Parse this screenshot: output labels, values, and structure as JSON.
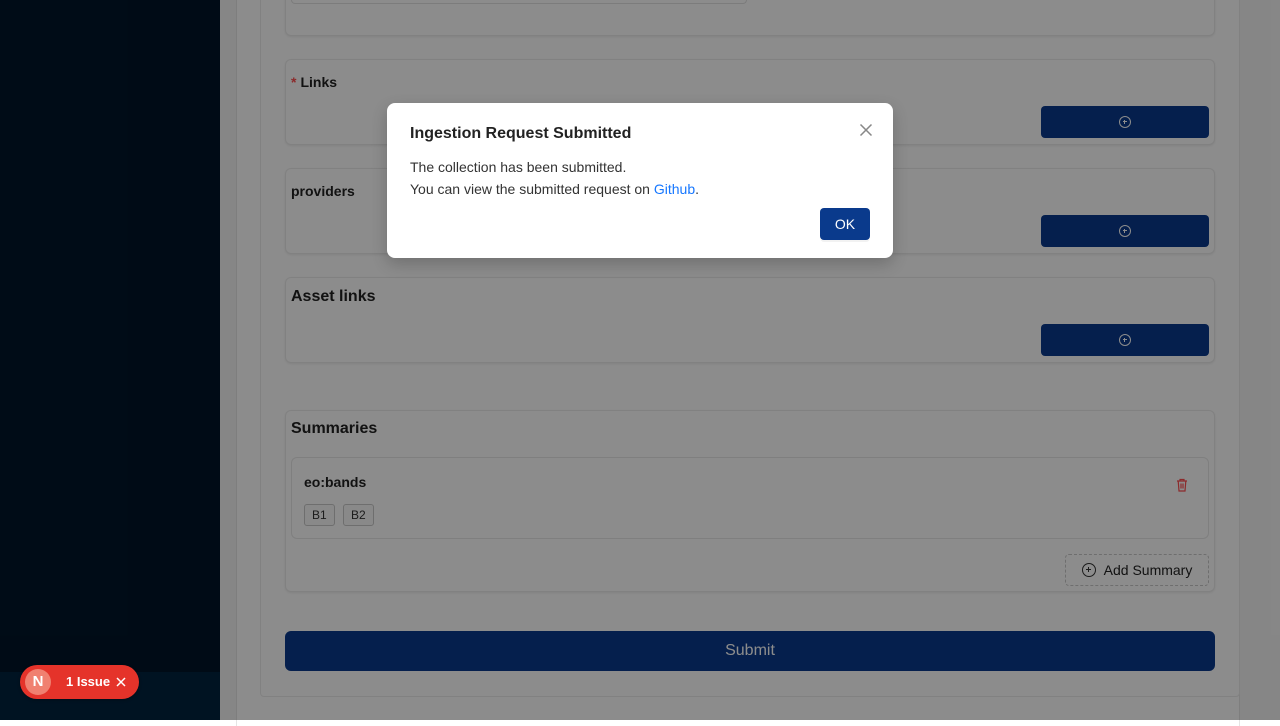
{
  "form": {
    "links_title": "Links",
    "required_mark": "*",
    "providers_title": "providers",
    "asset_links_title": "Asset links",
    "summaries": {
      "title": "Summaries",
      "item_name": "eo:bands",
      "tags": [
        "B1",
        "B2"
      ],
      "add_summary_label": "Add Summary"
    },
    "submit_label": "Submit"
  },
  "issues_badge": {
    "logo_letter": "N",
    "label": "1 Issue"
  },
  "modal": {
    "title": "Ingestion Request Submitted",
    "line1": "The collection has been submitted.",
    "line2_prefix": "You can view the submitted request on ",
    "link_text": "Github",
    "line2_suffix": ".",
    "ok_label": "OK"
  },
  "colors": {
    "primary": "#0a3a8c",
    "sidebar": "#001529",
    "danger": "#e5332a",
    "link": "#1677ff"
  },
  "icons": [
    "plus-circle-icon",
    "delete-icon",
    "close-icon",
    "nextjs-logo-icon"
  ]
}
